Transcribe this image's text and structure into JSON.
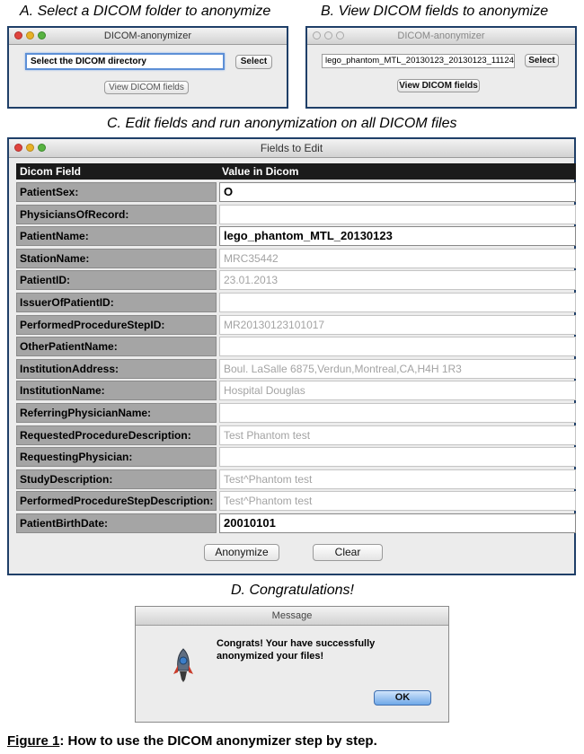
{
  "steps": {
    "a": "A. Select a DICOM folder to anonymize",
    "b": "B. View DICOM fields to anonymize",
    "c": "C. Edit fields and run anonymization on all DICOM files",
    "d": "D. Congratulations!"
  },
  "window_a": {
    "title": "DICOM-anonymizer",
    "directory_value": "Select the DICOM directory",
    "select_label": "Select",
    "view_fields_label": "View DICOM fields"
  },
  "window_b": {
    "title": "DICOM-anonymizer",
    "directory_value": "lego_phantom_MTL_20130123_20130123_11124",
    "select_label": "Select",
    "view_fields_label": "View DICOM fields"
  },
  "window_c": {
    "title": "Fields to Edit",
    "columns": [
      "Dicom Field",
      "Value in Dicom"
    ],
    "rows": [
      {
        "field": "PatientSex:",
        "value": "O"
      },
      {
        "field": "PhysiciansOfRecord:",
        "value": ""
      },
      {
        "field": "PatientName:",
        "value": "lego_phantom_MTL_20130123"
      },
      {
        "field": "StationName:",
        "value": "MRC35442"
      },
      {
        "field": "PatientID:",
        "value": "23.01.2013"
      },
      {
        "field": "IssuerOfPatientID:",
        "value": ""
      },
      {
        "field": "PerformedProcedureStepID:",
        "value": "MR20130123101017"
      },
      {
        "field": "OtherPatientName:",
        "value": ""
      },
      {
        "field": "InstitutionAddress:",
        "value": "Boul. LaSalle 6875,Verdun,Montreal,CA,H4H 1R3"
      },
      {
        "field": "InstitutionName:",
        "value": "Hospital Douglas"
      },
      {
        "field": "ReferringPhysicianName:",
        "value": ""
      },
      {
        "field": "RequestedProcedureDescription:",
        "value": "Test Phantom test"
      },
      {
        "field": "RequestingPhysician:",
        "value": ""
      },
      {
        "field": "StudyDescription:",
        "value": "Test^Phantom test"
      },
      {
        "field": "PerformedProcedureStepDescription:",
        "value": "Test^Phantom test"
      },
      {
        "field": "PatientBirthDate:",
        "value": "20010101"
      }
    ],
    "anonymize_label": "Anonymize",
    "clear_label": "Clear"
  },
  "window_d": {
    "title": "Message",
    "message_line1": "Congrats! Your have successfully",
    "message_line2": "anonymized your files!",
    "ok_label": "OK"
  },
  "figure_caption": {
    "label": "Figure 1",
    "text": ": How to use the DICOM anonymizer step by step."
  }
}
